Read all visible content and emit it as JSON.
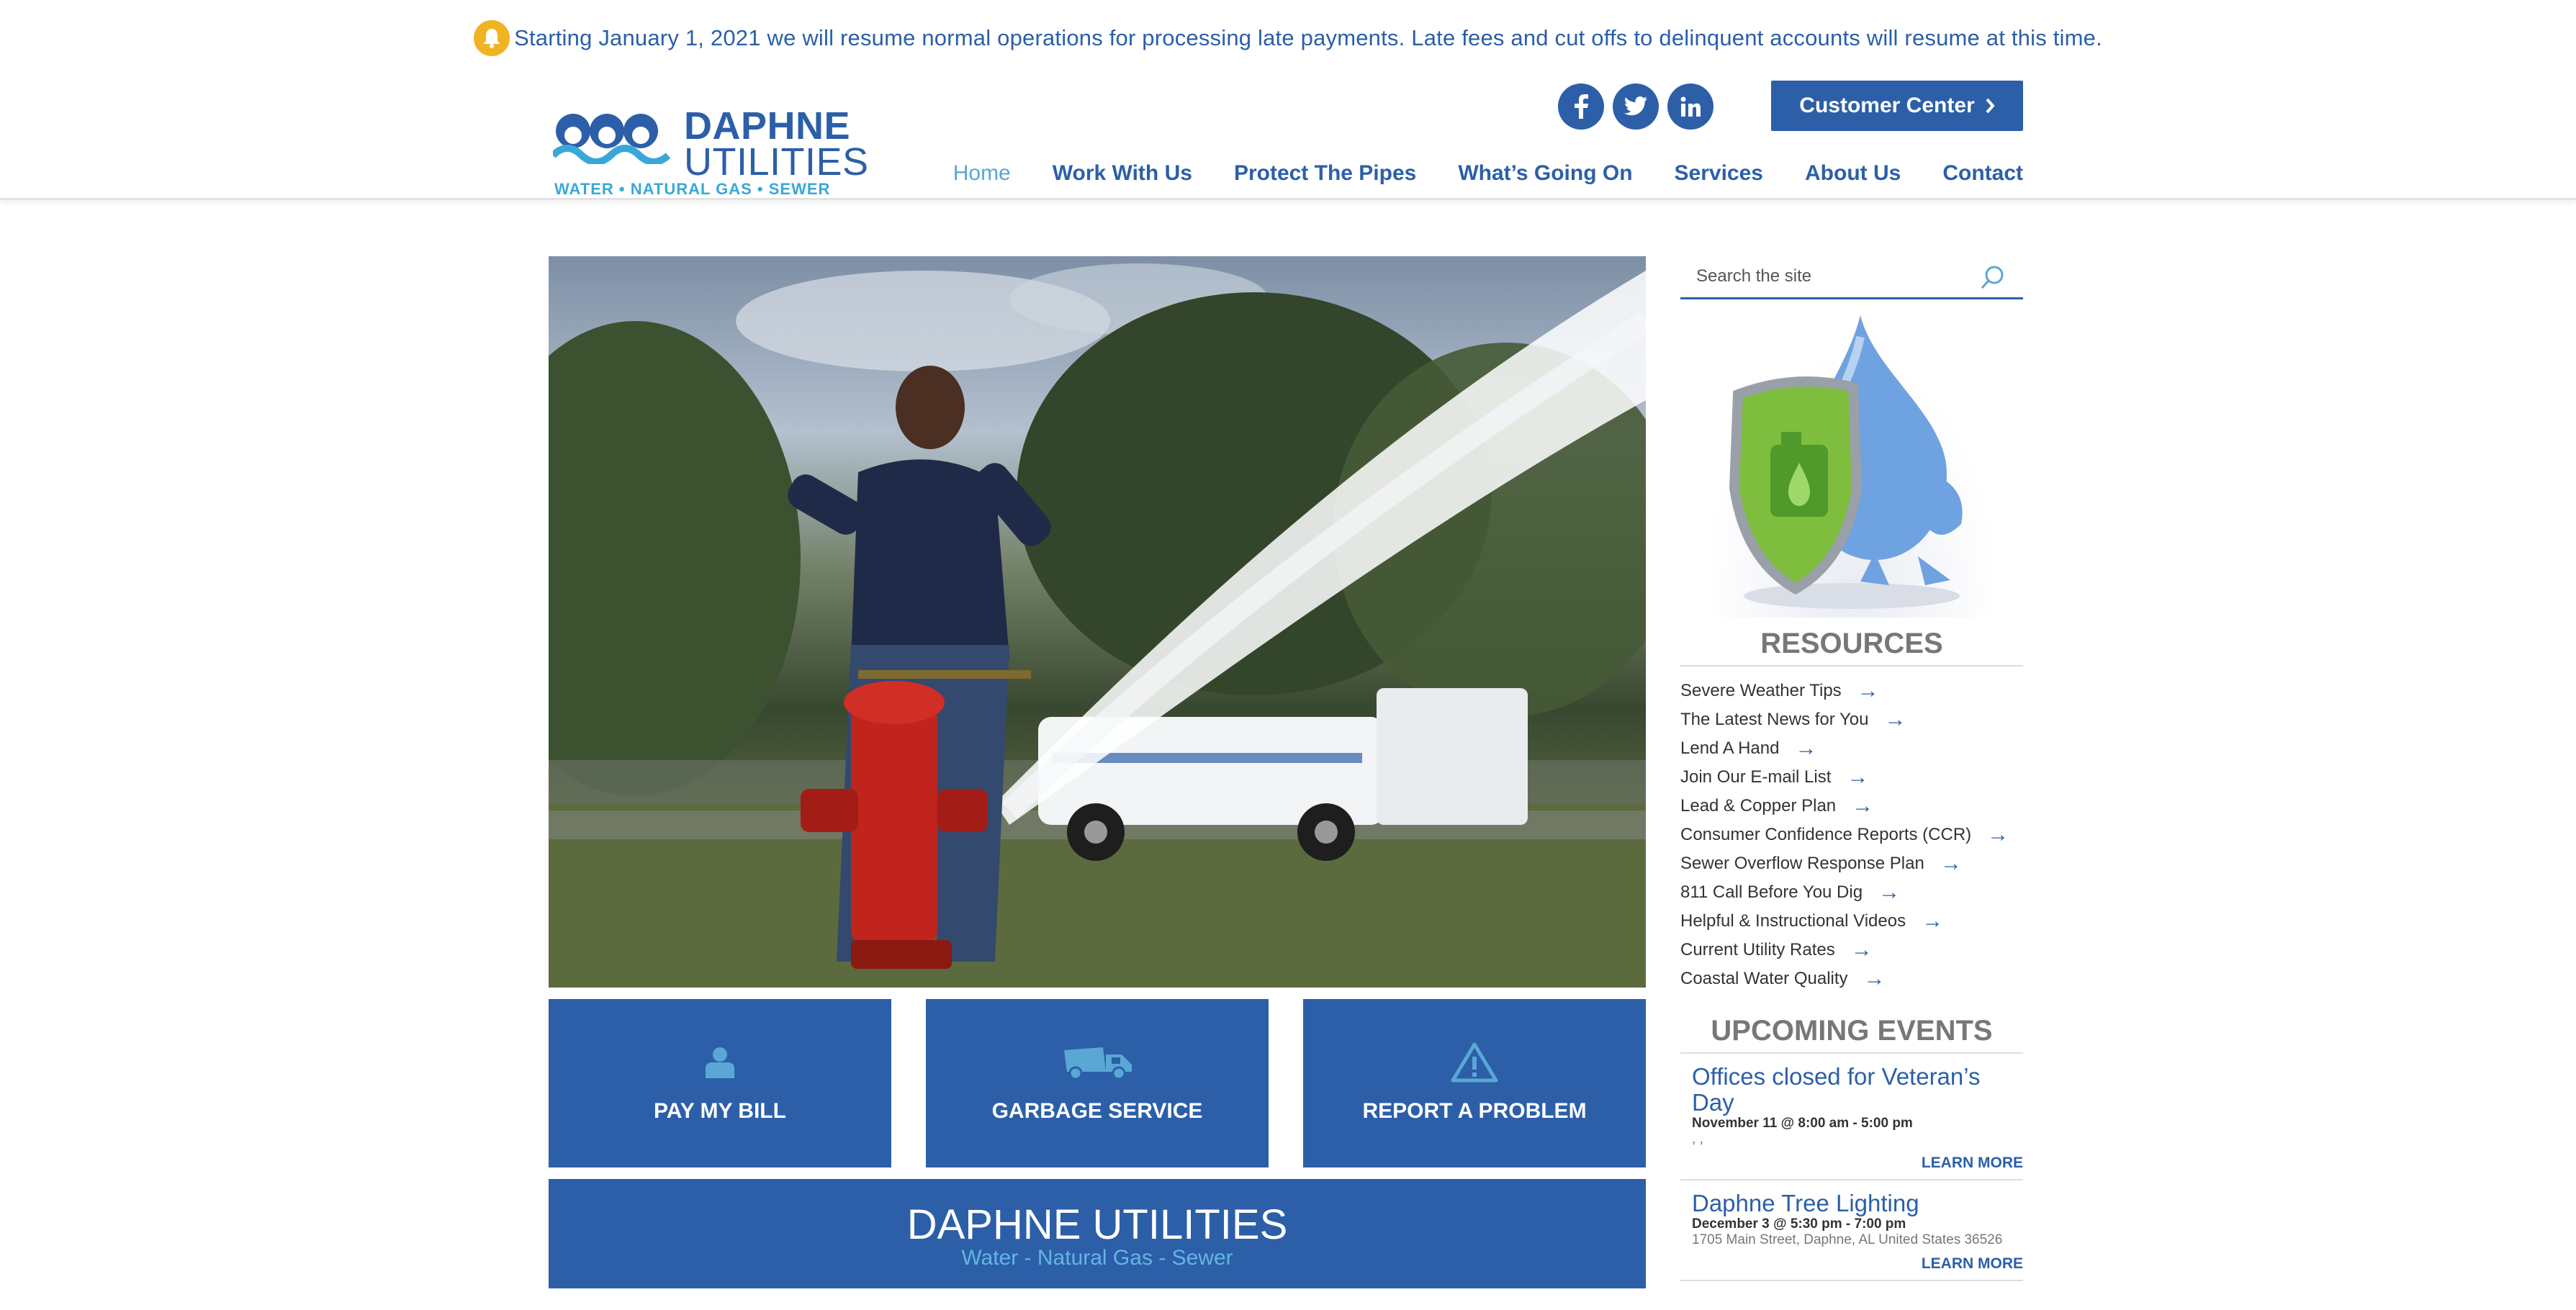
{
  "alert": {
    "text": "Starting January 1, 2021 we will resume normal operations for processing late payments. Late fees and cut offs to delinquent accounts will resume at this time."
  },
  "logo": {
    "line1": "DAPHNE",
    "line2": "UTILITIES",
    "tagline": "WATER • NATURAL GAS • SEWER"
  },
  "social": {
    "facebook": "f",
    "twitter": "t",
    "linkedin": "in"
  },
  "customer_center": {
    "label": "Customer Center"
  },
  "nav": {
    "items": [
      {
        "label": "Home"
      },
      {
        "label": "Work With Us"
      },
      {
        "label": "Protect The Pipes"
      },
      {
        "label": "What’s Going On"
      },
      {
        "label": "Services"
      },
      {
        "label": "About Us"
      },
      {
        "label": "Contact"
      }
    ]
  },
  "tiles": [
    {
      "label": "PAY MY BILL",
      "icon": "person-icon"
    },
    {
      "label": "GARBAGE SERVICE",
      "icon": "garbage-truck-icon"
    },
    {
      "label": "REPORT A PROBLEM",
      "icon": "warning-icon"
    }
  ],
  "brand": {
    "title": "DAPHNE UTILITIES",
    "subtitle": "Water - Natural Gas - Sewer"
  },
  "search": {
    "placeholder": "Search the site"
  },
  "resources": {
    "title": "RESOURCES",
    "items": [
      {
        "label": "Severe Weather Tips"
      },
      {
        "label": "The Latest News for You"
      },
      {
        "label": "Lend A Hand"
      },
      {
        "label": "Join Our E-mail List"
      },
      {
        "label": "Lead & Copper Plan"
      },
      {
        "label": "Consumer Confidence Reports (CCR)"
      },
      {
        "label": "Sewer Overflow Response Plan"
      },
      {
        "label": "811 Call Before You Dig"
      },
      {
        "label": "Helpful & Instructional Videos"
      },
      {
        "label": "Current Utility Rates"
      },
      {
        "label": "Coastal Water Quality"
      }
    ]
  },
  "events": {
    "title": "UPCOMING EVENTS",
    "items": [
      {
        "title": "Offices closed for Veteran’s Day",
        "date": "November 11 @ 8:00 am - 5:00 pm",
        "location": ", ,",
        "more": "LEARN MORE"
      },
      {
        "title": "Daphne Tree Lighting",
        "date": "December 3 @ 5:30 pm - 7:00 pm",
        "location": "1705 Main Street, Daphne, AL United States 36526",
        "more": "LEARN MORE"
      }
    ]
  },
  "colors": {
    "primary": "#2c5fa8",
    "accent": "#5aa7d6",
    "alert": "#f0b323"
  }
}
